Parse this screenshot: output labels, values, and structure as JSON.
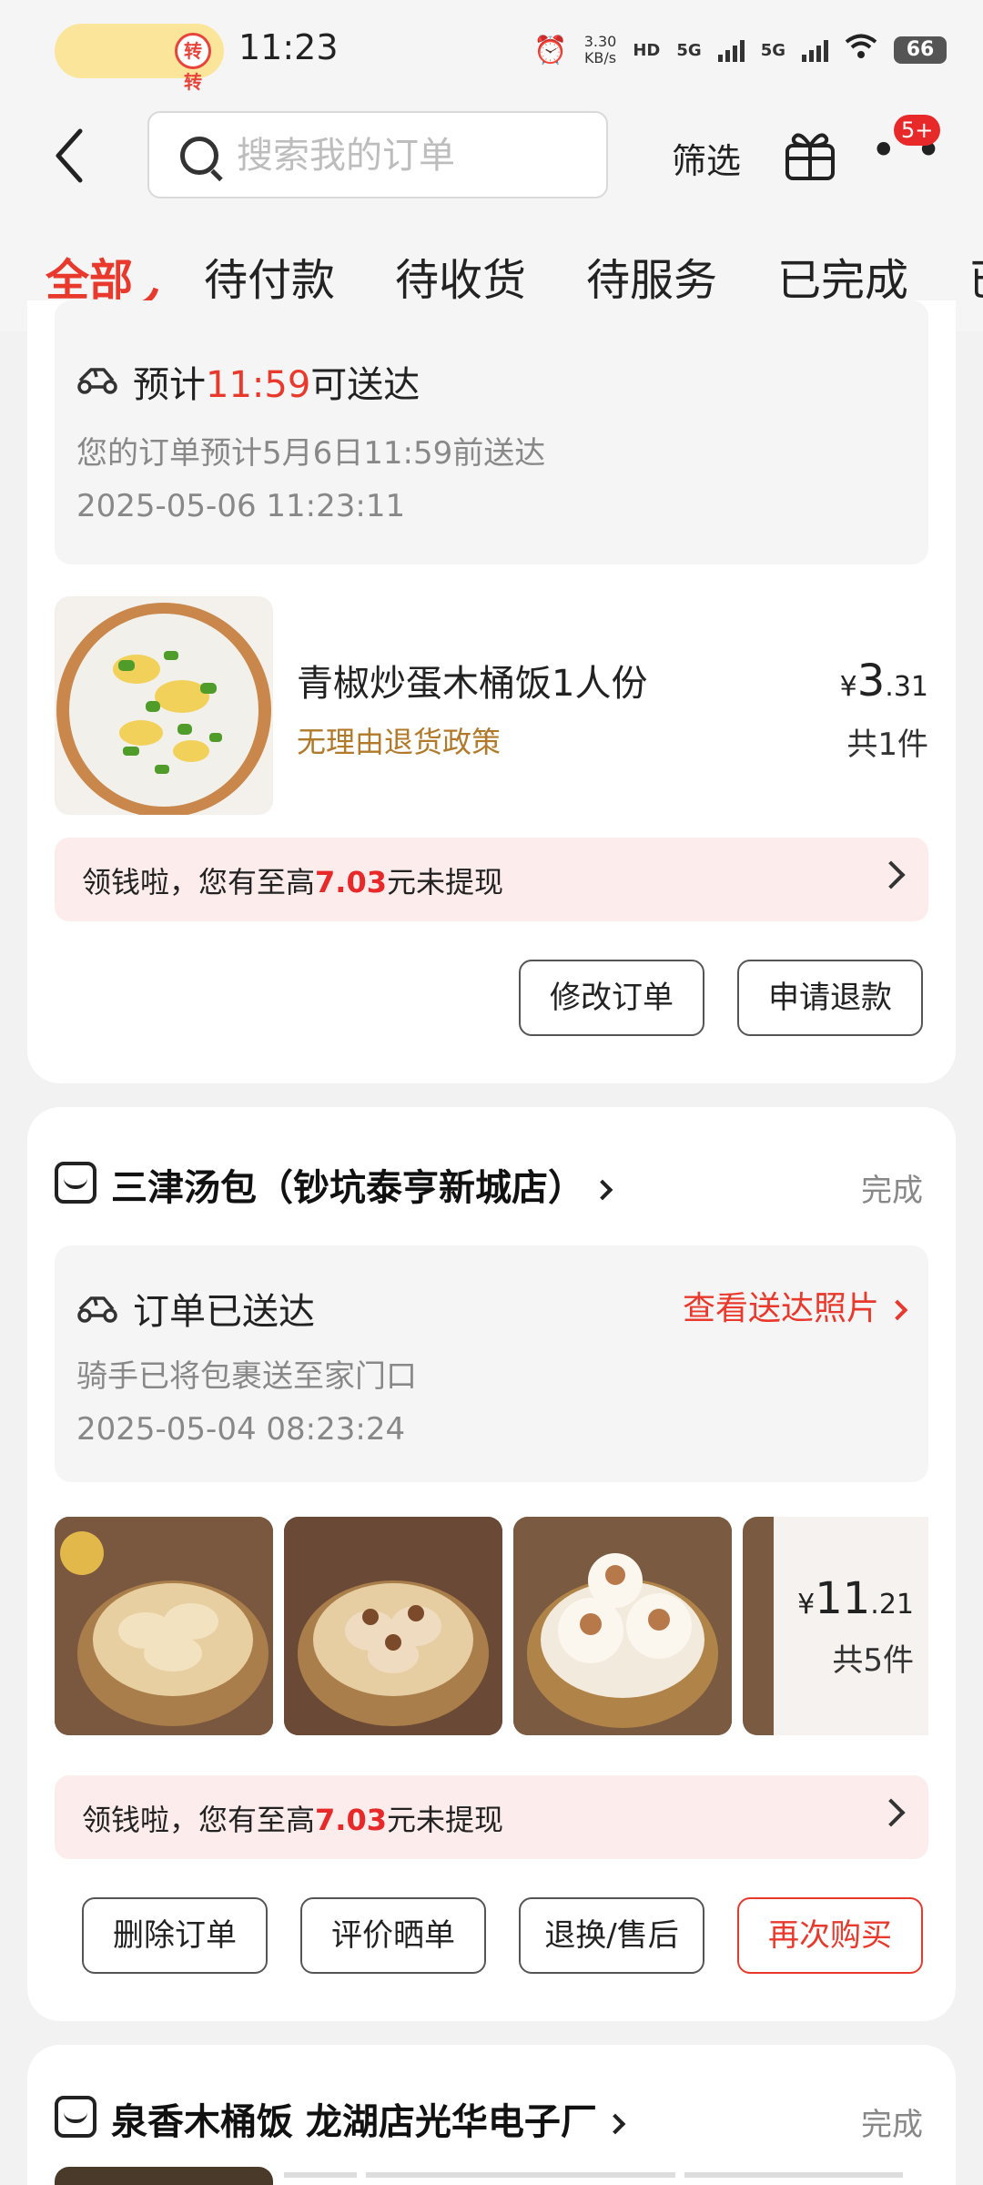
{
  "status_bar": {
    "pill_badge": "转转",
    "time": "11:23",
    "net_speed": "3.30",
    "net_unit": "KB/s",
    "hd_label": "HD",
    "sig1_label": "5G",
    "sig2_label": "5G",
    "battery": "66"
  },
  "header": {
    "search_placeholder": "搜索我的订单",
    "filter_label": "筛选",
    "more_badge": "5+"
  },
  "tabs": [
    {
      "label": "全部"
    },
    {
      "label": "待付款"
    },
    {
      "label": "待收货"
    },
    {
      "label": "待服务"
    },
    {
      "label": "已完成"
    },
    {
      "label": "已"
    }
  ],
  "orders": [
    {
      "delivery_title_prefix": "预计",
      "delivery_time": "11:59",
      "delivery_title_suffix": "可送达",
      "delivery_note": "您的订单预计5月6日11:59前送达",
      "timestamp": "2025-05-06 11:23:11",
      "product_name": "青椒炒蛋木桶饭1人份",
      "policy": "无理由退货政策",
      "price_symbol": "¥",
      "price_int": "3",
      "price_dec": ".31",
      "qty": "共1件",
      "promo_prefix": "领钱啦，您有至高",
      "promo_amount": "7.03",
      "promo_suffix": "元未提现",
      "buttons": [
        "修改订单",
        "申请退款"
      ]
    },
    {
      "store_name": "三津汤包（钞坑泰亨新城店）",
      "status": "完成",
      "delivery_title": "订单已送达",
      "delivery_link": "查看送达照片",
      "delivery_note": "骑手已将包裹送至家门口",
      "timestamp": "2025-05-04 08:23:24",
      "price_symbol": "¥",
      "price_int": "11",
      "price_dec": ".21",
      "qty": "共5件",
      "promo_prefix": "领钱啦，您有至高",
      "promo_amount": "7.03",
      "promo_suffix": "元未提现",
      "buttons": [
        "删除订单",
        "评价晒单",
        "退换/售后",
        "再次购买"
      ]
    },
    {
      "store_name": "泉香木桶饭 龙湖店光华电子厂",
      "status": "完成"
    }
  ],
  "colors": {
    "accent_red": "#e8392c",
    "policy_gold": "#b07a2a",
    "promo_bg": "#fcecec"
  }
}
